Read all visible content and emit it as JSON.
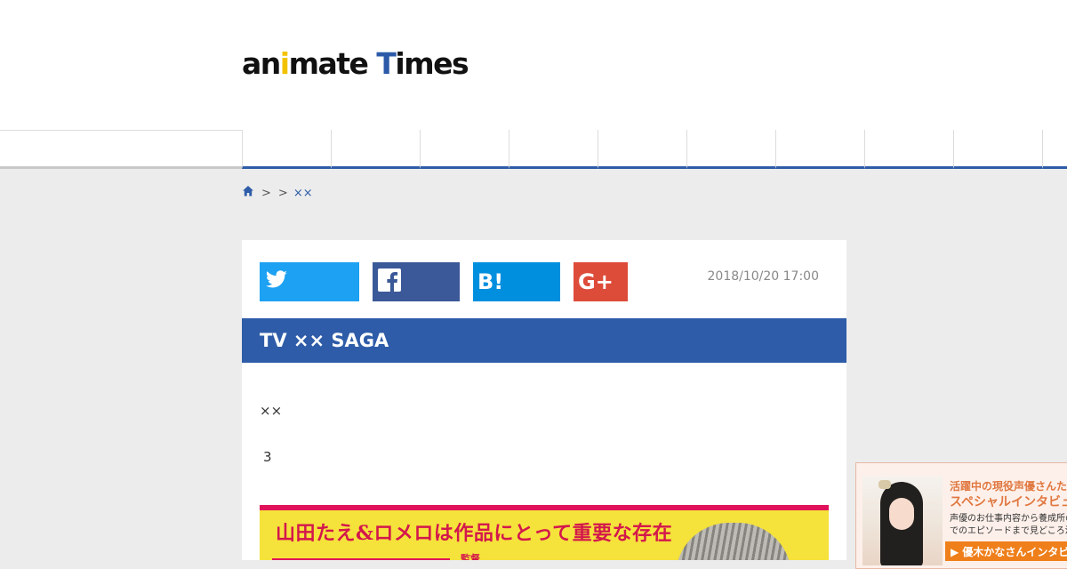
{
  "header": {
    "logo_text": "animate Times"
  },
  "nav": {
    "items": [
      "",
      "",
      "",
      "",
      "",
      "",
      "",
      "",
      "",
      ""
    ]
  },
  "breadcrumb": {
    "separator_1": ">",
    "separator_2": ">",
    "current": "××"
  },
  "article": {
    "share": {
      "twitter_icon": "twitter-bird-icon",
      "facebook_icon": "facebook-f-icon",
      "hatena_icon": "hatena-bookmark-icon",
      "hatena_label": "B!",
      "gplus_icon": "google-plus-icon",
      "gplus_label": "G+"
    },
    "date": "2018/10/20 17:00",
    "title": "TV ×× SAGA",
    "para1": "××",
    "para2": "3",
    "hero_caption": "山田たえ&ロメロは作品にとって重要な存在",
    "hero_side_text": "監督"
  },
  "ad": {
    "line1": "活躍中の現役声優さんた",
    "line2": "スペシャルインタビュー",
    "line3": "声優のお仕事内容から養成所の",
    "line4": "でのエピソードまで見どころ満",
    "cta": "▶ 優木かなさんインタビ"
  },
  "colors": {
    "brand_blue": "#2e5ca8",
    "twitter": "#1da1f2",
    "facebook": "#3b5998",
    "hatena": "#008fde",
    "gplus": "#dd4b39",
    "logo_yellow": "#f2c200"
  }
}
